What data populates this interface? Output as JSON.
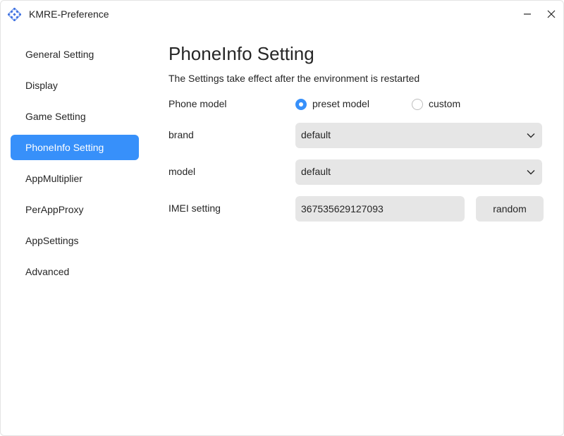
{
  "window": {
    "title": "KMRE-Preference",
    "icon": "app-grid-icon",
    "controls": {
      "minimize": "minimize-icon",
      "close": "close-icon"
    }
  },
  "sidebar": {
    "items": [
      {
        "label": "General Setting",
        "active": false
      },
      {
        "label": "Display",
        "active": false
      },
      {
        "label": "Game Setting",
        "active": false
      },
      {
        "label": "PhoneInfo Setting",
        "active": true
      },
      {
        "label": "AppMultiplier",
        "active": false
      },
      {
        "label": "PerAppProxy",
        "active": false
      },
      {
        "label": "AppSettings",
        "active": false
      },
      {
        "label": "Advanced",
        "active": false
      }
    ]
  },
  "main": {
    "title": "PhoneInfo Setting",
    "subtitle": "The Settings take effect after the environment is restarted",
    "phone_model": {
      "label": "Phone model",
      "options": [
        {
          "label": "preset model",
          "checked": true
        },
        {
          "label": "custom",
          "checked": false
        }
      ]
    },
    "brand": {
      "label": "brand",
      "value": "default"
    },
    "model": {
      "label": "model",
      "value": "default"
    },
    "imei": {
      "label": "IMEI setting",
      "value": "367535629127093",
      "button_label": "random"
    }
  },
  "colors": {
    "accent": "#3790fa",
    "field_bg": "#e6e6e6",
    "text": "#262626",
    "window_bg": "#ffffff"
  }
}
